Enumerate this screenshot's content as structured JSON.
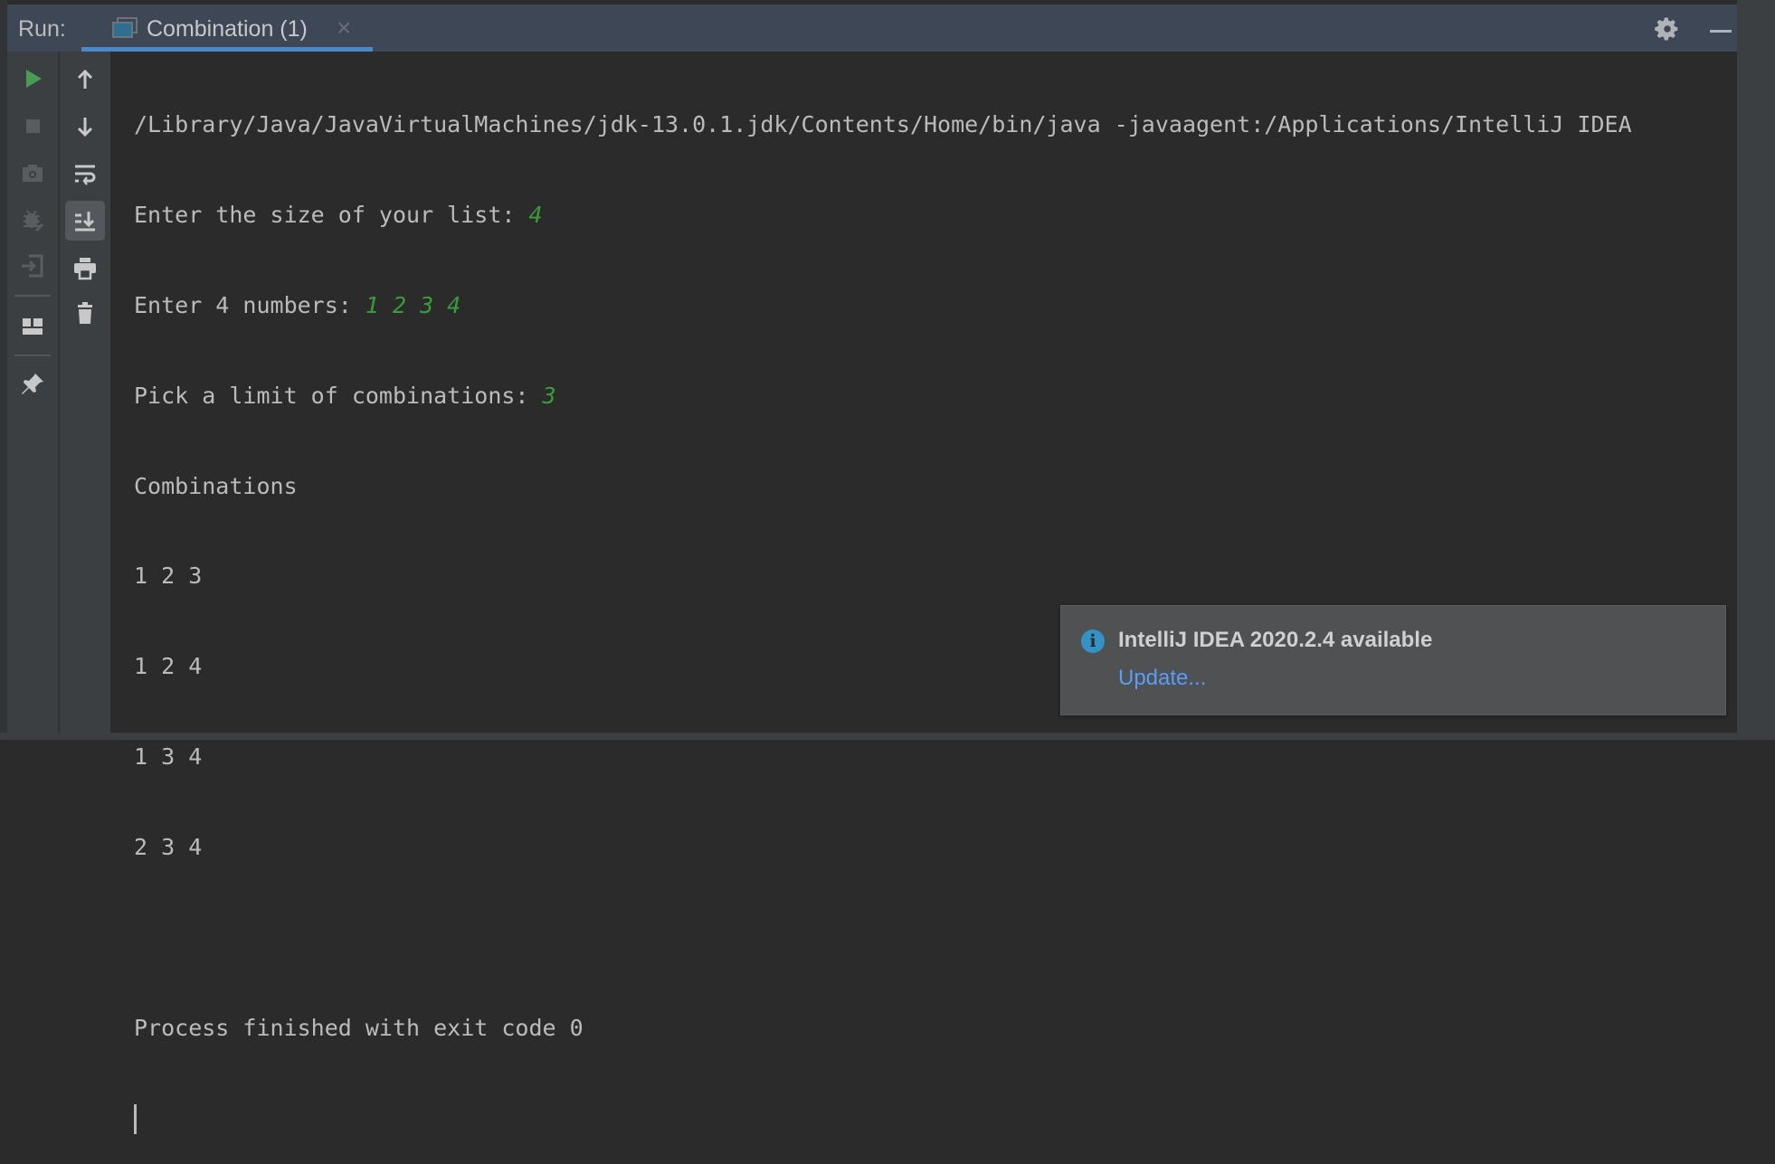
{
  "header": {
    "run_label": "Run:",
    "tab_label": "Combination (1)",
    "close_glyph": "×"
  },
  "colors": {
    "accent": "#4a88c7",
    "input": "#3a9b3a",
    "run_green": "#499c54",
    "info": "#3592c4",
    "link": "#589df6"
  },
  "left_toolbar": [
    "rerun-icon",
    "stop-icon",
    "snapshot-icon",
    "debug-icon",
    "restore-layout-icon",
    "layout-icon",
    "pin-icon"
  ],
  "right_toolbar": [
    "up-icon",
    "down-icon",
    "soft-wrap-icon",
    "scroll-to-end-icon",
    "print-icon",
    "trash-icon"
  ],
  "console": {
    "command": "/Library/Java/JavaVirtualMachines/jdk-13.0.1.jdk/Contents/Home/bin/java -javaagent:/Applications/IntelliJ IDEA",
    "prompt1": "Enter the size of your list: ",
    "input1": "4",
    "prompt2": "Enter 4 numbers: ",
    "input2": "1 2 3 4",
    "prompt3": "Pick a limit of combinations: ",
    "input3": "3",
    "heading": "Combinations",
    "results": [
      "1 2 3",
      "1 2 4",
      "1 3 4",
      "2 3 4"
    ],
    "exit": "Process finished with exit code 0"
  },
  "notification": {
    "title": "IntelliJ IDEA 2020.2.4 available",
    "link": "Update..."
  }
}
